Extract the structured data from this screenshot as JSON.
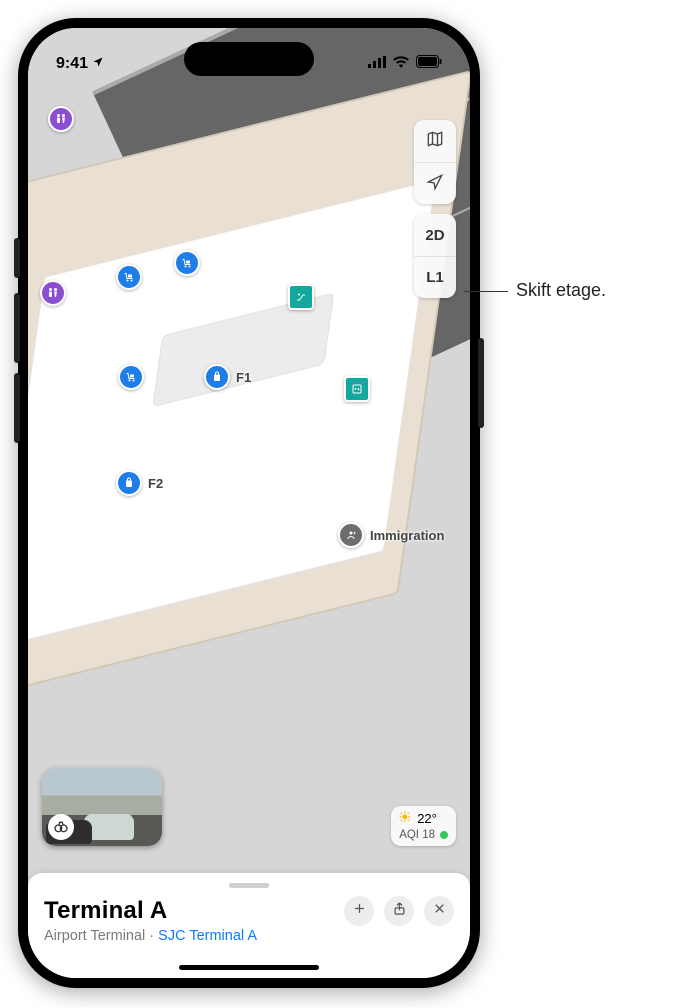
{
  "status": {
    "time": "9:41",
    "location_arrow": "▸"
  },
  "controls": {
    "mode_label": "2D",
    "floor_label": "L1"
  },
  "poi": {
    "f1_label": "F1",
    "f2_label": "F2",
    "immigration_label": "Immigration"
  },
  "weather": {
    "temp": "22°",
    "aqi_label": "AQI 18"
  },
  "card": {
    "title": "Terminal A",
    "subtitle_category": "Airport Terminal",
    "separator": " · ",
    "subtitle_link": "SJC Terminal A"
  },
  "callout": {
    "text": "Skift etage."
  },
  "colors": {
    "link": "#0a7aff",
    "poi_blue": "#1f7de8",
    "poi_purple": "#8a4fd0",
    "poi_teal": "#13a89e",
    "poi_gray": "#6d6d6d",
    "aqi_green": "#35c759"
  }
}
